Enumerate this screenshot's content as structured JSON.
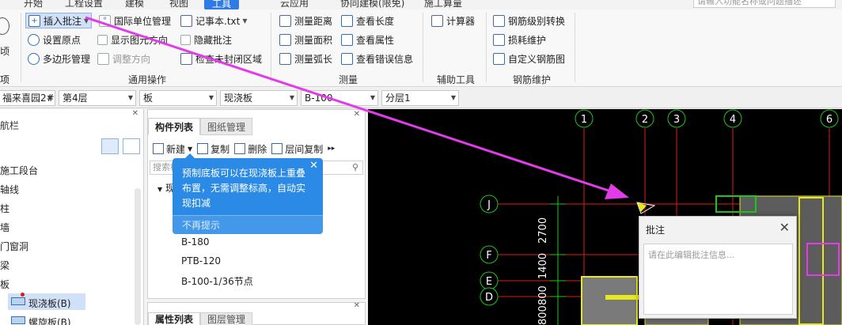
{
  "menubar": {
    "tabs": [
      "开始",
      "工程设置",
      "建模",
      "视图",
      "工具",
      "云应用",
      "协同建模(限免)",
      "施工算量"
    ],
    "active_tab": "工具",
    "search_placeholder": "请输入功能名称或问题描述"
  },
  "ribbon": {
    "left_partial": {
      "line1": "顷",
      "group": "项"
    },
    "general": {
      "insert_note": "插入批注",
      "intl_units": "国际单位管理",
      "notepad": "记事本.txt",
      "set_origin": "设置原点",
      "show_origin_dir": "显示图元方向",
      "hide_note": "隐藏批注",
      "polygon_mgmt": "多边形管理",
      "adjust_dir": "调整方向",
      "check_unclosed": "检查未封闭区域",
      "group_label": "通用操作"
    },
    "measure": {
      "distance": "测量距离",
      "area": "测量面积",
      "arc": "测量弧长",
      "view_length": "查看长度",
      "view_attr": "查看属性",
      "view_errors": "查看错误信息",
      "group_label": "测量"
    },
    "aux": {
      "calculator": "计算器",
      "group_label": "辅助工具"
    },
    "rebar": {
      "grade_convert": "钢筋级别转换",
      "loss_maint": "损耗维护",
      "custom_shape": "自定义钢筋图",
      "group_label": "钢筋维护"
    }
  },
  "dropdowns": {
    "project": "福来喜园2#",
    "floor": "第4层",
    "category": "板",
    "type": "现浇板",
    "component": "B-100",
    "layer": "分层1"
  },
  "left_panel": {
    "title": "航栏",
    "items": [
      "施工段台",
      "轴线",
      "柱",
      "墙",
      "门窗洞",
      "梁",
      "板",
      "现浇板(B)",
      "螺旋板(B)"
    ],
    "selected": "现浇板(B)"
  },
  "component_panel": {
    "tabs": [
      "构件列表",
      "图纸管理"
    ],
    "tools": {
      "new": "新建",
      "copy": "复制",
      "delete": "删除",
      "floor_copy": "层间复制"
    },
    "search_placeholder": "搜索构件...",
    "tree_root": "现浇板",
    "items": [
      "B-180",
      "PTB-120",
      "B-100-1/36节点"
    ]
  },
  "property_panel": {
    "tabs": [
      "属性列表",
      "图层管理"
    ]
  },
  "tooltip": {
    "text": "预制底板可以在现浇板上重叠布置，无需调整标高，自动实现扣减",
    "dismiss": "不再提示"
  },
  "canvas": {
    "axis_top": [
      "1",
      "2",
      "3",
      "4",
      "6"
    ],
    "axis_left": [
      "J",
      "F",
      "E",
      "D"
    ],
    "dims": [
      "2700",
      "1400",
      "800",
      "800"
    ]
  },
  "dialog": {
    "title": "批注",
    "placeholder": "请在此编辑批注信息..."
  },
  "colors": {
    "accent": "#2f7ae5",
    "tooltip": "#2b8ae6",
    "arrow": "#e23ce8",
    "grid_red": "#e01a1a",
    "grid_green": "#19c819",
    "yellow": "#e8e81e"
  }
}
